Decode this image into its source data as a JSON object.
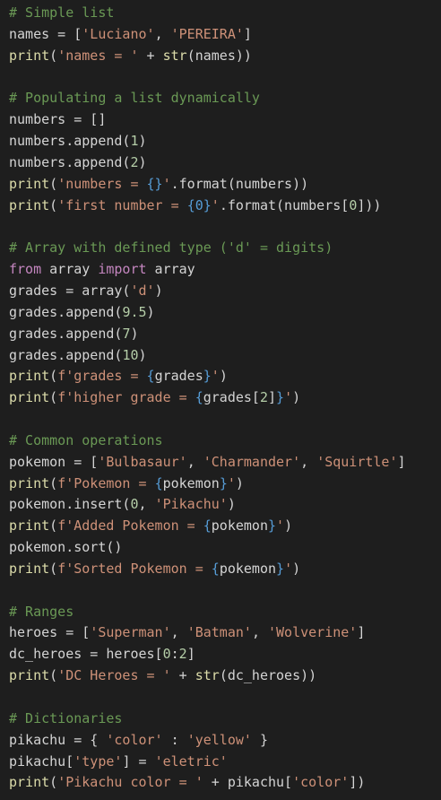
{
  "editor": {
    "background": "#1e1e1e",
    "theme_colors": {
      "comment": "#6a9955",
      "string": "#ce9178",
      "builtin": "#dcdcaa",
      "keyword": "#c586c0",
      "number": "#b5cea8",
      "brace": "#569cd6",
      "default": "#d4d4d4"
    },
    "lines": [
      [
        [
          "# Simple list",
          "comment"
        ]
      ],
      [
        [
          "names = [",
          "default"
        ],
        [
          "'Luciano'",
          "string"
        ],
        [
          ", ",
          "default"
        ],
        [
          "'PEREIRA'",
          "string"
        ],
        [
          "]",
          "default"
        ]
      ],
      [
        [
          "print",
          "builtin"
        ],
        [
          "(",
          "default"
        ],
        [
          "'names = '",
          "string"
        ],
        [
          " + ",
          "default"
        ],
        [
          "str",
          "builtin"
        ],
        [
          "(names))",
          "default"
        ]
      ],
      [],
      [
        [
          "# Populating a list dynamically",
          "comment"
        ]
      ],
      [
        [
          "numbers = []",
          "default"
        ]
      ],
      [
        [
          "numbers.append(",
          "default"
        ],
        [
          "1",
          "number"
        ],
        [
          ")",
          "default"
        ]
      ],
      [
        [
          "numbers.append(",
          "default"
        ],
        [
          "2",
          "number"
        ],
        [
          ")",
          "default"
        ]
      ],
      [
        [
          "print",
          "builtin"
        ],
        [
          "(",
          "default"
        ],
        [
          "'numbers = ",
          "string"
        ],
        [
          "{}",
          "brace"
        ],
        [
          "'",
          "string"
        ],
        [
          ".format(numbers))",
          "default"
        ]
      ],
      [
        [
          "print",
          "builtin"
        ],
        [
          "(",
          "default"
        ],
        [
          "'first number = ",
          "string"
        ],
        [
          "{0}",
          "brace"
        ],
        [
          "'",
          "string"
        ],
        [
          ".format(numbers[",
          "default"
        ],
        [
          "0",
          "number"
        ],
        [
          "]))",
          "default"
        ]
      ],
      [],
      [
        [
          "# Array with defined type ('d' = digits)",
          "comment"
        ]
      ],
      [
        [
          "from",
          "keyword"
        ],
        [
          " array ",
          "default"
        ],
        [
          "import",
          "keyword"
        ],
        [
          " array",
          "default"
        ]
      ],
      [
        [
          "grades = array(",
          "default"
        ],
        [
          "'d'",
          "string"
        ],
        [
          ")",
          "default"
        ]
      ],
      [
        [
          "grades.append(",
          "default"
        ],
        [
          "9.5",
          "number"
        ],
        [
          ")",
          "default"
        ]
      ],
      [
        [
          "grades.append(",
          "default"
        ],
        [
          "7",
          "number"
        ],
        [
          ")",
          "default"
        ]
      ],
      [
        [
          "grades.append(",
          "default"
        ],
        [
          "10",
          "number"
        ],
        [
          ")",
          "default"
        ]
      ],
      [
        [
          "print",
          "builtin"
        ],
        [
          "(",
          "default"
        ],
        [
          "f'grades = ",
          "string"
        ],
        [
          "{",
          "brace"
        ],
        [
          "grades",
          "default"
        ],
        [
          "}",
          "brace"
        ],
        [
          "'",
          "string"
        ],
        [
          ")",
          "default"
        ]
      ],
      [
        [
          "print",
          "builtin"
        ],
        [
          "(",
          "default"
        ],
        [
          "f'higher grade = ",
          "string"
        ],
        [
          "{",
          "brace"
        ],
        [
          "grades[",
          "default"
        ],
        [
          "2",
          "number"
        ],
        [
          "]",
          "default"
        ],
        [
          "}",
          "brace"
        ],
        [
          "'",
          "string"
        ],
        [
          ")",
          "default"
        ]
      ],
      [],
      [
        [
          "# Common operations",
          "comment"
        ]
      ],
      [
        [
          "pokemon = [",
          "default"
        ],
        [
          "'Bulbasaur'",
          "string"
        ],
        [
          ", ",
          "default"
        ],
        [
          "'Charmander'",
          "string"
        ],
        [
          ", ",
          "default"
        ],
        [
          "'Squirtle'",
          "string"
        ],
        [
          "]",
          "default"
        ]
      ],
      [
        [
          "print",
          "builtin"
        ],
        [
          "(",
          "default"
        ],
        [
          "f'Pokemon = ",
          "string"
        ],
        [
          "{",
          "brace"
        ],
        [
          "pokemon",
          "default"
        ],
        [
          "}",
          "brace"
        ],
        [
          "'",
          "string"
        ],
        [
          ")",
          "default"
        ]
      ],
      [
        [
          "pokemon.insert(",
          "default"
        ],
        [
          "0",
          "number"
        ],
        [
          ", ",
          "default"
        ],
        [
          "'Pikachu'",
          "string"
        ],
        [
          ")",
          "default"
        ]
      ],
      [
        [
          "print",
          "builtin"
        ],
        [
          "(",
          "default"
        ],
        [
          "f'Added Pokemon = ",
          "string"
        ],
        [
          "{",
          "brace"
        ],
        [
          "pokemon",
          "default"
        ],
        [
          "}",
          "brace"
        ],
        [
          "'",
          "string"
        ],
        [
          ")",
          "default"
        ]
      ],
      [
        [
          "pokemon.sort()",
          "default"
        ]
      ],
      [
        [
          "print",
          "builtin"
        ],
        [
          "(",
          "default"
        ],
        [
          "f'Sorted Pokemon = ",
          "string"
        ],
        [
          "{",
          "brace"
        ],
        [
          "pokemon",
          "default"
        ],
        [
          "}",
          "brace"
        ],
        [
          "'",
          "string"
        ],
        [
          ")",
          "default"
        ]
      ],
      [],
      [
        [
          "# Ranges",
          "comment"
        ]
      ],
      [
        [
          "heroes = [",
          "default"
        ],
        [
          "'Superman'",
          "string"
        ],
        [
          ", ",
          "default"
        ],
        [
          "'Batman'",
          "string"
        ],
        [
          ", ",
          "default"
        ],
        [
          "'Wolverine'",
          "string"
        ],
        [
          "]",
          "default"
        ]
      ],
      [
        [
          "dc_heroes = heroes[",
          "default"
        ],
        [
          "0",
          "number"
        ],
        [
          ":",
          "default"
        ],
        [
          "2",
          "number"
        ],
        [
          "]",
          "default"
        ]
      ],
      [
        [
          "print",
          "builtin"
        ],
        [
          "(",
          "default"
        ],
        [
          "'DC Heroes = '",
          "string"
        ],
        [
          " + ",
          "default"
        ],
        [
          "str",
          "builtin"
        ],
        [
          "(dc_heroes))",
          "default"
        ]
      ],
      [],
      [
        [
          "# Dictionaries",
          "comment"
        ]
      ],
      [
        [
          "pikachu = { ",
          "default"
        ],
        [
          "'color'",
          "string"
        ],
        [
          " : ",
          "default"
        ],
        [
          "'yellow'",
          "string"
        ],
        [
          " }",
          "default"
        ]
      ],
      [
        [
          "pikachu[",
          "default"
        ],
        [
          "'type'",
          "string"
        ],
        [
          "] = ",
          "default"
        ],
        [
          "'eletric'",
          "string"
        ]
      ],
      [
        [
          "print",
          "builtin"
        ],
        [
          "(",
          "default"
        ],
        [
          "'Pikachu color = '",
          "string"
        ],
        [
          " + pikachu[",
          "default"
        ],
        [
          "'color'",
          "string"
        ],
        [
          "])",
          "default"
        ]
      ]
    ]
  }
}
